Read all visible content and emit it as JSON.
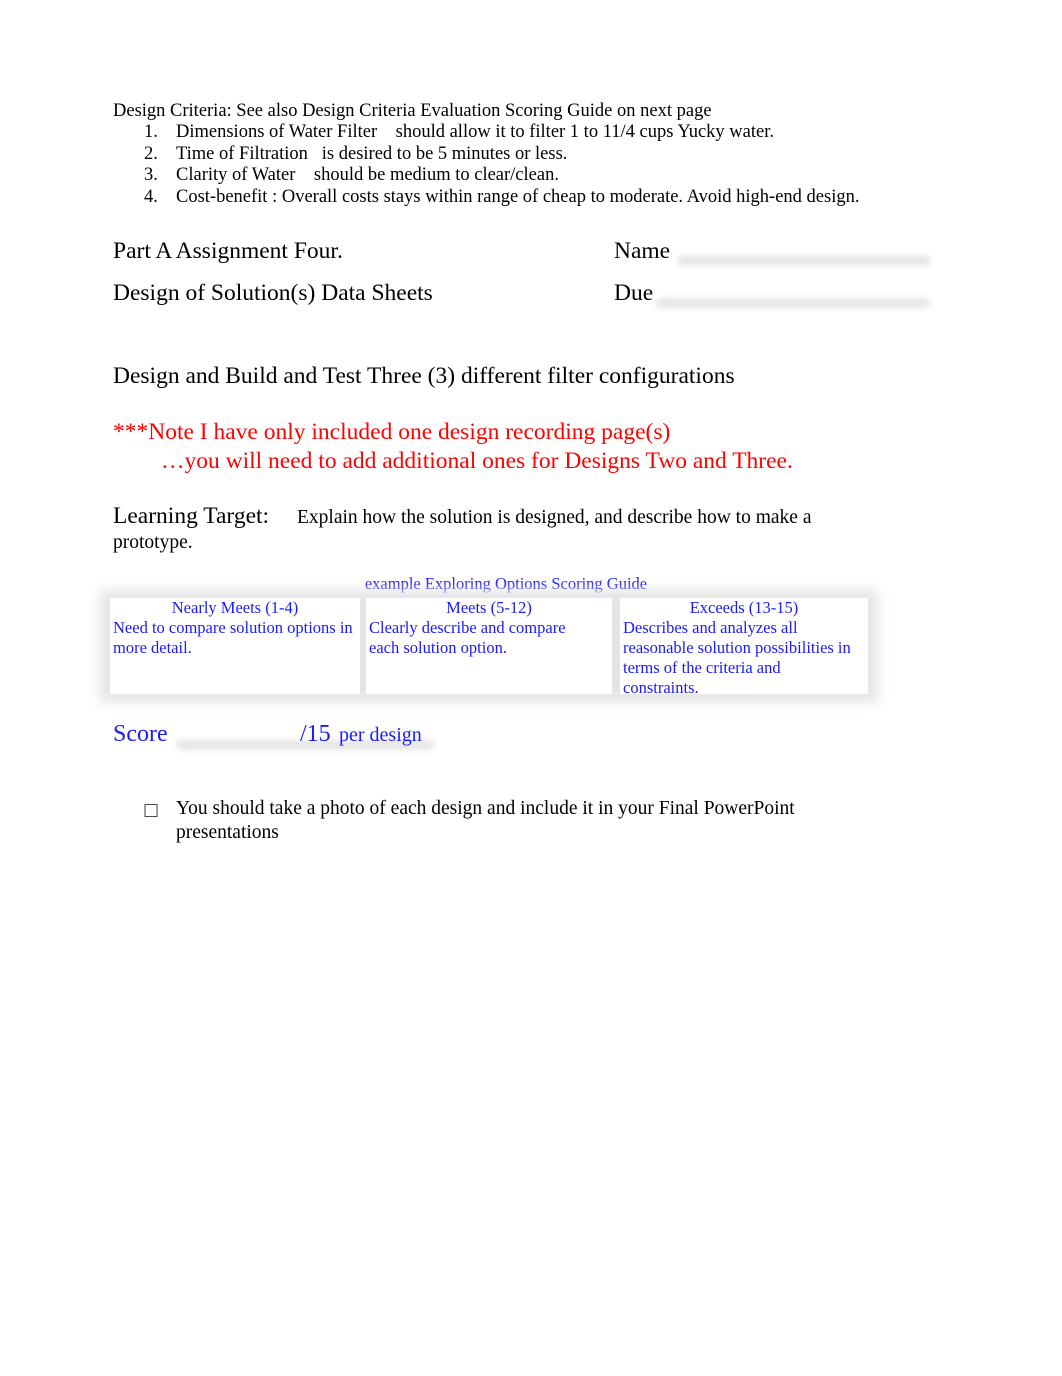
{
  "criteria": {
    "heading": "Design Criteria: See also Design Criteria Evaluation Scoring Guide on next page",
    "items": [
      {
        "num": "1.",
        "text": "Dimensions of Water Filter    should allow it to filter 1 to 11/4 cups Yucky water."
      },
      {
        "num": "2.",
        "text": "Time of Filtration   is desired to be 5 minutes or less."
      },
      {
        "num": "3.",
        "text": "Clarity of Water    should be medium to clear/clean."
      },
      {
        "num": "4.",
        "text": "Cost-benefit : Overall costs stays within range of cheap to moderate. Avoid high-end design."
      }
    ]
  },
  "header": {
    "assignment_title": "Part A Assignment Four.",
    "subtitle": "Design of Solution(s) Data Sheets",
    "name_label": "Name",
    "due_label": "Due"
  },
  "instruction": "Design and Build and Test Three (3) different filter configurations",
  "note": {
    "line1": "***Note I have only included one design recording page(s)",
    "line2": "…you will need to add additional ones for Designs Two and Three."
  },
  "learning_target": {
    "label": "Learning Target:",
    "text_line1": "Explain how the solution is designed, and describe how to make a",
    "text_line2": "prototype."
  },
  "scoring_guide": {
    "title": "example Exploring Options Scoring Guide",
    "columns": [
      {
        "heading": "Nearly Meets (1-4)",
        "description": "Need to compare solution options in more detail."
      },
      {
        "heading": "Meets (5-12)",
        "description": "Clearly describe and compare each solution option."
      },
      {
        "heading": "Exceeds (13-15)",
        "description": "Describes and analyzes all reasonable solution possibilities in terms of the criteria and constraints."
      }
    ]
  },
  "score": {
    "label": "Score",
    "max": "/15",
    "suffix": "per design"
  },
  "bullets": [
    {
      "icon": "",
      "text": "You should take a photo of each design and include it in your Final PowerPoint presentations"
    }
  ],
  "colors": {
    "note_red": "#ff0000",
    "guide_blue": "#1a1aff"
  }
}
